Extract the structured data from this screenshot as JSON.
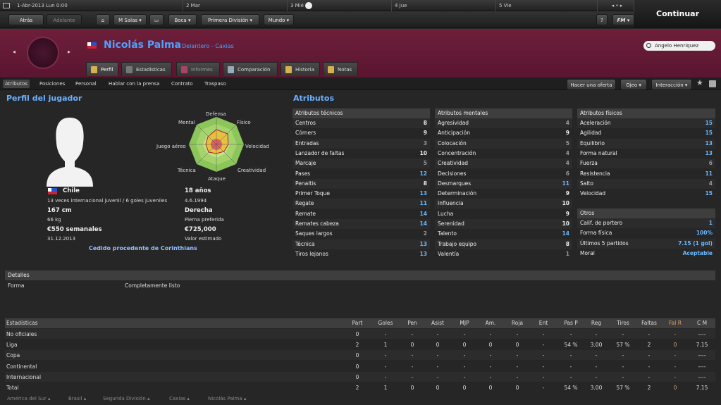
{
  "topbar": {
    "date": "1-Abr-2013 Lun 0:00",
    "days": [
      "2 Mar",
      "3 Mié",
      "4 Jue",
      "5 Vie"
    ]
  },
  "continue_label": "Continuar",
  "nav": {
    "back": "Atrás",
    "forward": "Adelante",
    "manager": "M Salas",
    "club": "Boca",
    "league": "Primera División",
    "world": "Mundo",
    "help": "?",
    "fm": "FM"
  },
  "player": {
    "name": "Nicolás Palma",
    "position": "Delantero - Caxias"
  },
  "search": {
    "value": "Angelo Henriquez"
  },
  "tabs": [
    "Perfil",
    "Estadísticas",
    "Informes",
    "Comparación",
    "Historia",
    "Notas"
  ],
  "subnav": [
    "Atributos",
    "Posiciones",
    "Personal",
    "Hablar con la prensa",
    "Contrato",
    "Traspaso"
  ],
  "actions": {
    "offer": "Hacer una oferta",
    "scout": "Ojeo",
    "interaction": "Interacción"
  },
  "profile": {
    "title": "Perfil del jugador",
    "nation": "Chile",
    "youth": "13 veces internacional juvenil / 6 goles juveniles",
    "age": "18 años",
    "dob": "4.6.1994",
    "height": "167 cm",
    "weight": "66 kg",
    "foot": "Derecha",
    "foot_label": "Pierna preferida",
    "wage": "€550 semanales",
    "contract": "31.12.2013",
    "value": "€725,000",
    "value_label": "Valor estimado",
    "loan": "Cedido procedente de Corinthians",
    "radar": [
      "Defensa",
      "Físico",
      "Velocidad",
      "Creatividad",
      "Ataque",
      "Técnica",
      "Juego aéreo",
      "Mental"
    ]
  },
  "attributes": {
    "title": "Atributos",
    "technical": {
      "title": "Atributos técnicos",
      "items": [
        [
          "Centros",
          "8"
        ],
        [
          "Córners",
          "9"
        ],
        [
          "Entradas",
          "3"
        ],
        [
          "Lanzador de faltas",
          "10"
        ],
        [
          "Marcaje",
          "5"
        ],
        [
          "Pases",
          "12"
        ],
        [
          "Penaltis",
          "8"
        ],
        [
          "Primer Toque",
          "13"
        ],
        [
          "Regate",
          "11"
        ],
        [
          "Remate",
          "14"
        ],
        [
          "Remates cabeza",
          "14"
        ],
        [
          "Saques largos",
          "2"
        ],
        [
          "Técnica",
          "13"
        ],
        [
          "Tiros lejanos",
          "13"
        ]
      ]
    },
    "mental": {
      "title": "Atributos mentales",
      "items": [
        [
          "Agresividad",
          "4"
        ],
        [
          "Anticipación",
          "9"
        ],
        [
          "Colocación",
          "5"
        ],
        [
          "Concentración",
          "4"
        ],
        [
          "Creatividad",
          "4"
        ],
        [
          "Decisiones",
          "6"
        ],
        [
          "Desmarques",
          "11"
        ],
        [
          "Determinación",
          "9"
        ],
        [
          "Influencia",
          "10"
        ],
        [
          "Lucha",
          "9"
        ],
        [
          "Serenidad",
          "10"
        ],
        [
          "Talento",
          "14"
        ],
        [
          "Trabajo equipo",
          "8"
        ],
        [
          "Valentía",
          "1"
        ]
      ]
    },
    "physical": {
      "title": "Atributos físicos",
      "items": [
        [
          "Aceleración",
          "15"
        ],
        [
          "Agilidad",
          "15"
        ],
        [
          "Equilibrio",
          "13"
        ],
        [
          "Forma natural",
          "13"
        ],
        [
          "Fuerza",
          "6"
        ],
        [
          "Resistencia",
          "11"
        ],
        [
          "Salto",
          "4"
        ],
        [
          "Velocidad",
          "15"
        ]
      ]
    },
    "others": {
      "title": "Otros",
      "items": [
        [
          "Calif. de portero",
          "1"
        ],
        [
          "Forma física",
          "100%"
        ],
        [
          "Últimos 5 partidos",
          "7.15 (1 gol)"
        ],
        [
          "Moral",
          "Aceptable"
        ]
      ]
    }
  },
  "details": {
    "title": "Detalles",
    "label": "Forma",
    "value": "Completamente listo"
  },
  "stats": {
    "headers": [
      "Estadísticas",
      "Part",
      "Goles",
      "Pen",
      "Asist",
      "MJP",
      "Am.",
      "Roja",
      "Ent",
      "Pas P",
      "Reg",
      "Tiros",
      "Faltas",
      "Fal R",
      "C M"
    ],
    "rows": [
      [
        "No oficiales",
        "0",
        "-",
        "-",
        "-",
        "-",
        "-",
        "-",
        "-",
        "-",
        "-",
        "-",
        "-",
        "-",
        "----"
      ],
      [
        "Liga",
        "2",
        "1",
        "0",
        "0",
        "0",
        "0",
        "0",
        "-",
        "54 %",
        "3.00",
        "57 %",
        "2",
        "0",
        "7.15"
      ],
      [
        "Copa",
        "0",
        "-",
        "-",
        "-",
        "-",
        "-",
        "-",
        "-",
        "-",
        "-",
        "-",
        "-",
        "-",
        "----"
      ],
      [
        "Continental",
        "0",
        "-",
        "-",
        "-",
        "-",
        "-",
        "-",
        "-",
        "-",
        "-",
        "-",
        "-",
        "-",
        "----"
      ],
      [
        "Internacional",
        "0",
        "-",
        "-",
        "-",
        "-",
        "-",
        "-",
        "-",
        "-",
        "-",
        "-",
        "-",
        "-",
        "----"
      ],
      [
        "Total",
        "2",
        "1",
        "0",
        "0",
        "0",
        "0",
        "0",
        "-",
        "54 %",
        "3.00",
        "57 %",
        "2",
        "0",
        "7.15"
      ]
    ]
  },
  "footer": [
    "América del Sur",
    "Brasil",
    "Segunda División",
    "Caxias",
    "Nicolás Palma"
  ]
}
